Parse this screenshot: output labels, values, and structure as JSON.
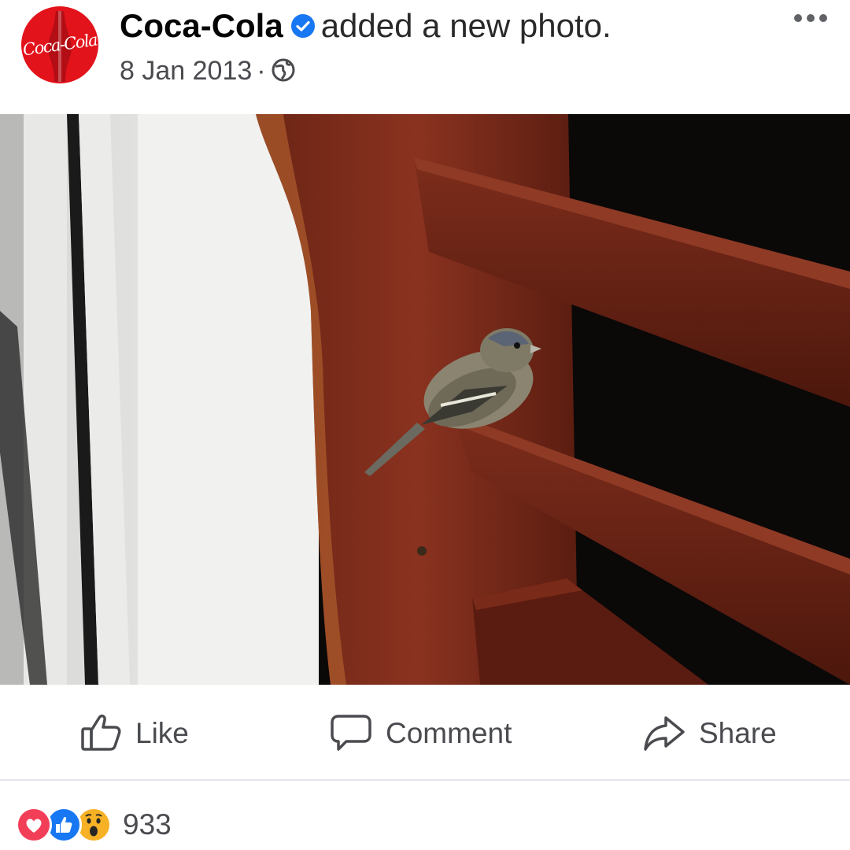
{
  "post": {
    "page_name": "Coca-Cola",
    "action_text": "added a new photo.",
    "date": "8 Jan 2013",
    "separator": "·",
    "avatar_text": "Coca-Cola",
    "audience_icon": "globe-icon",
    "verified_icon": "verified-badge-icon",
    "more_icon": "more-options-icon"
  },
  "photo": {
    "subject": "bird"
  },
  "actions": {
    "like_label": "Like",
    "comment_label": "Comment",
    "share_label": "Share"
  },
  "reactions": {
    "icons": [
      "love-reaction-icon",
      "like-reaction-icon",
      "wow-reaction-icon"
    ],
    "count": "933"
  },
  "colors": {
    "brand_red": "#e3131b",
    "verified_blue": "#1877f2",
    "text_secondary": "#4a4b4f",
    "love_red": "#f33e58",
    "like_blue": "#1877f2",
    "wow_yellow": "#f7b125"
  }
}
